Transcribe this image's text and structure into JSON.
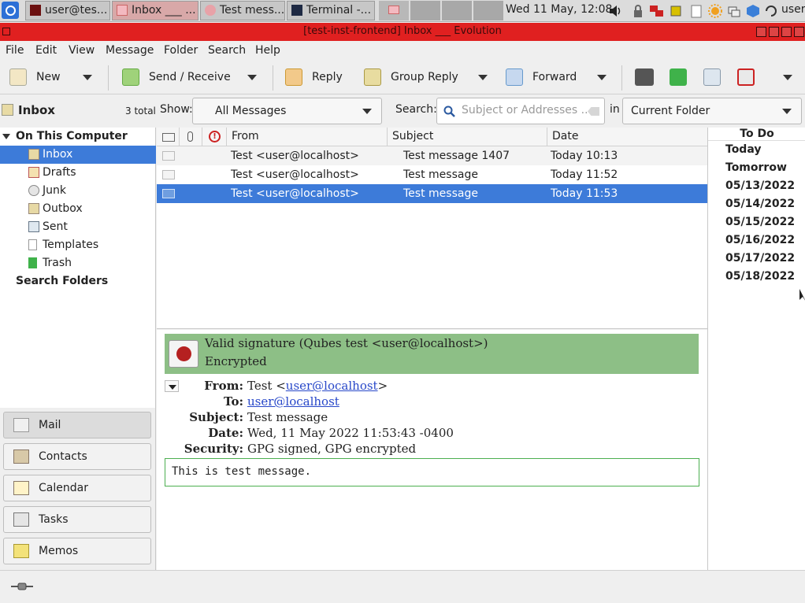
{
  "taskbar": {
    "tasks": [
      {
        "label": "user@tes..."
      },
      {
        "label": "Inbox ___ ..."
      },
      {
        "label": "Test mess..."
      },
      {
        "label": "Terminal -..."
      }
    ],
    "clock": "Wed 11 May, 12:08",
    "user": "user"
  },
  "window": {
    "title": "[test-inst-frontend] Inbox ___ Evolution"
  },
  "menubar": [
    "File",
    "Edit",
    "View",
    "Message",
    "Folder",
    "Search",
    "Help"
  ],
  "toolbar": {
    "new": "New",
    "send_receive": "Send / Receive",
    "reply": "Reply",
    "group_reply": "Group Reply",
    "forward": "Forward"
  },
  "searchbar": {
    "folder_name": "Inbox",
    "total": "3 total",
    "show_label": "Show:",
    "show_value": "All Messages",
    "search_label": "Search:",
    "search_placeholder": "Subject or Addresses ...",
    "in_label": "in",
    "scope_value": "Current Folder"
  },
  "folders": {
    "group": "On This Computer",
    "items": [
      "Inbox",
      "Drafts",
      "Junk",
      "Outbox",
      "Sent",
      "Templates",
      "Trash"
    ],
    "search_folders": "Search Folders"
  },
  "switcher": [
    "Mail",
    "Contacts",
    "Calendar",
    "Tasks",
    "Memos"
  ],
  "message_list": {
    "columns": {
      "from": "From",
      "subject": "Subject",
      "date": "Date"
    },
    "rows": [
      {
        "from": "Test <user@localhost>",
        "subject": "Test message 1407",
        "date": "Today 10:13"
      },
      {
        "from": "Test <user@localhost>",
        "subject": "Test message",
        "date": "Today 11:52"
      },
      {
        "from": "Test <user@localhost>",
        "subject": "Test message",
        "date": "Today 11:53"
      }
    ]
  },
  "todo": {
    "title": "To Do",
    "dates": [
      "Today",
      "Tomorrow",
      "05/13/2022",
      "05/14/2022",
      "05/15/2022",
      "05/16/2022",
      "05/17/2022",
      "05/18/2022"
    ]
  },
  "preview": {
    "signature": "Valid signature (Qubes test <user@localhost>)",
    "encrypted": "Encrypted",
    "from_label": "From:",
    "from_name": "Test <",
    "from_email": "user@localhost",
    "from_close": ">",
    "to_label": "To:",
    "to_email": "user@localhost",
    "subject_label": "Subject:",
    "subject": "Test message",
    "date_label": "Date:",
    "date": "Wed, 11 May 2022 11:53:43 -0400",
    "security_label": "Security:",
    "security": "GPG signed, GPG encrypted",
    "body": "This is test message."
  },
  "colors": {
    "titlebar": "#e02020",
    "selection": "#3d7bd9",
    "signature_bg": "#8dbf86",
    "body_border": "#4caf50"
  }
}
